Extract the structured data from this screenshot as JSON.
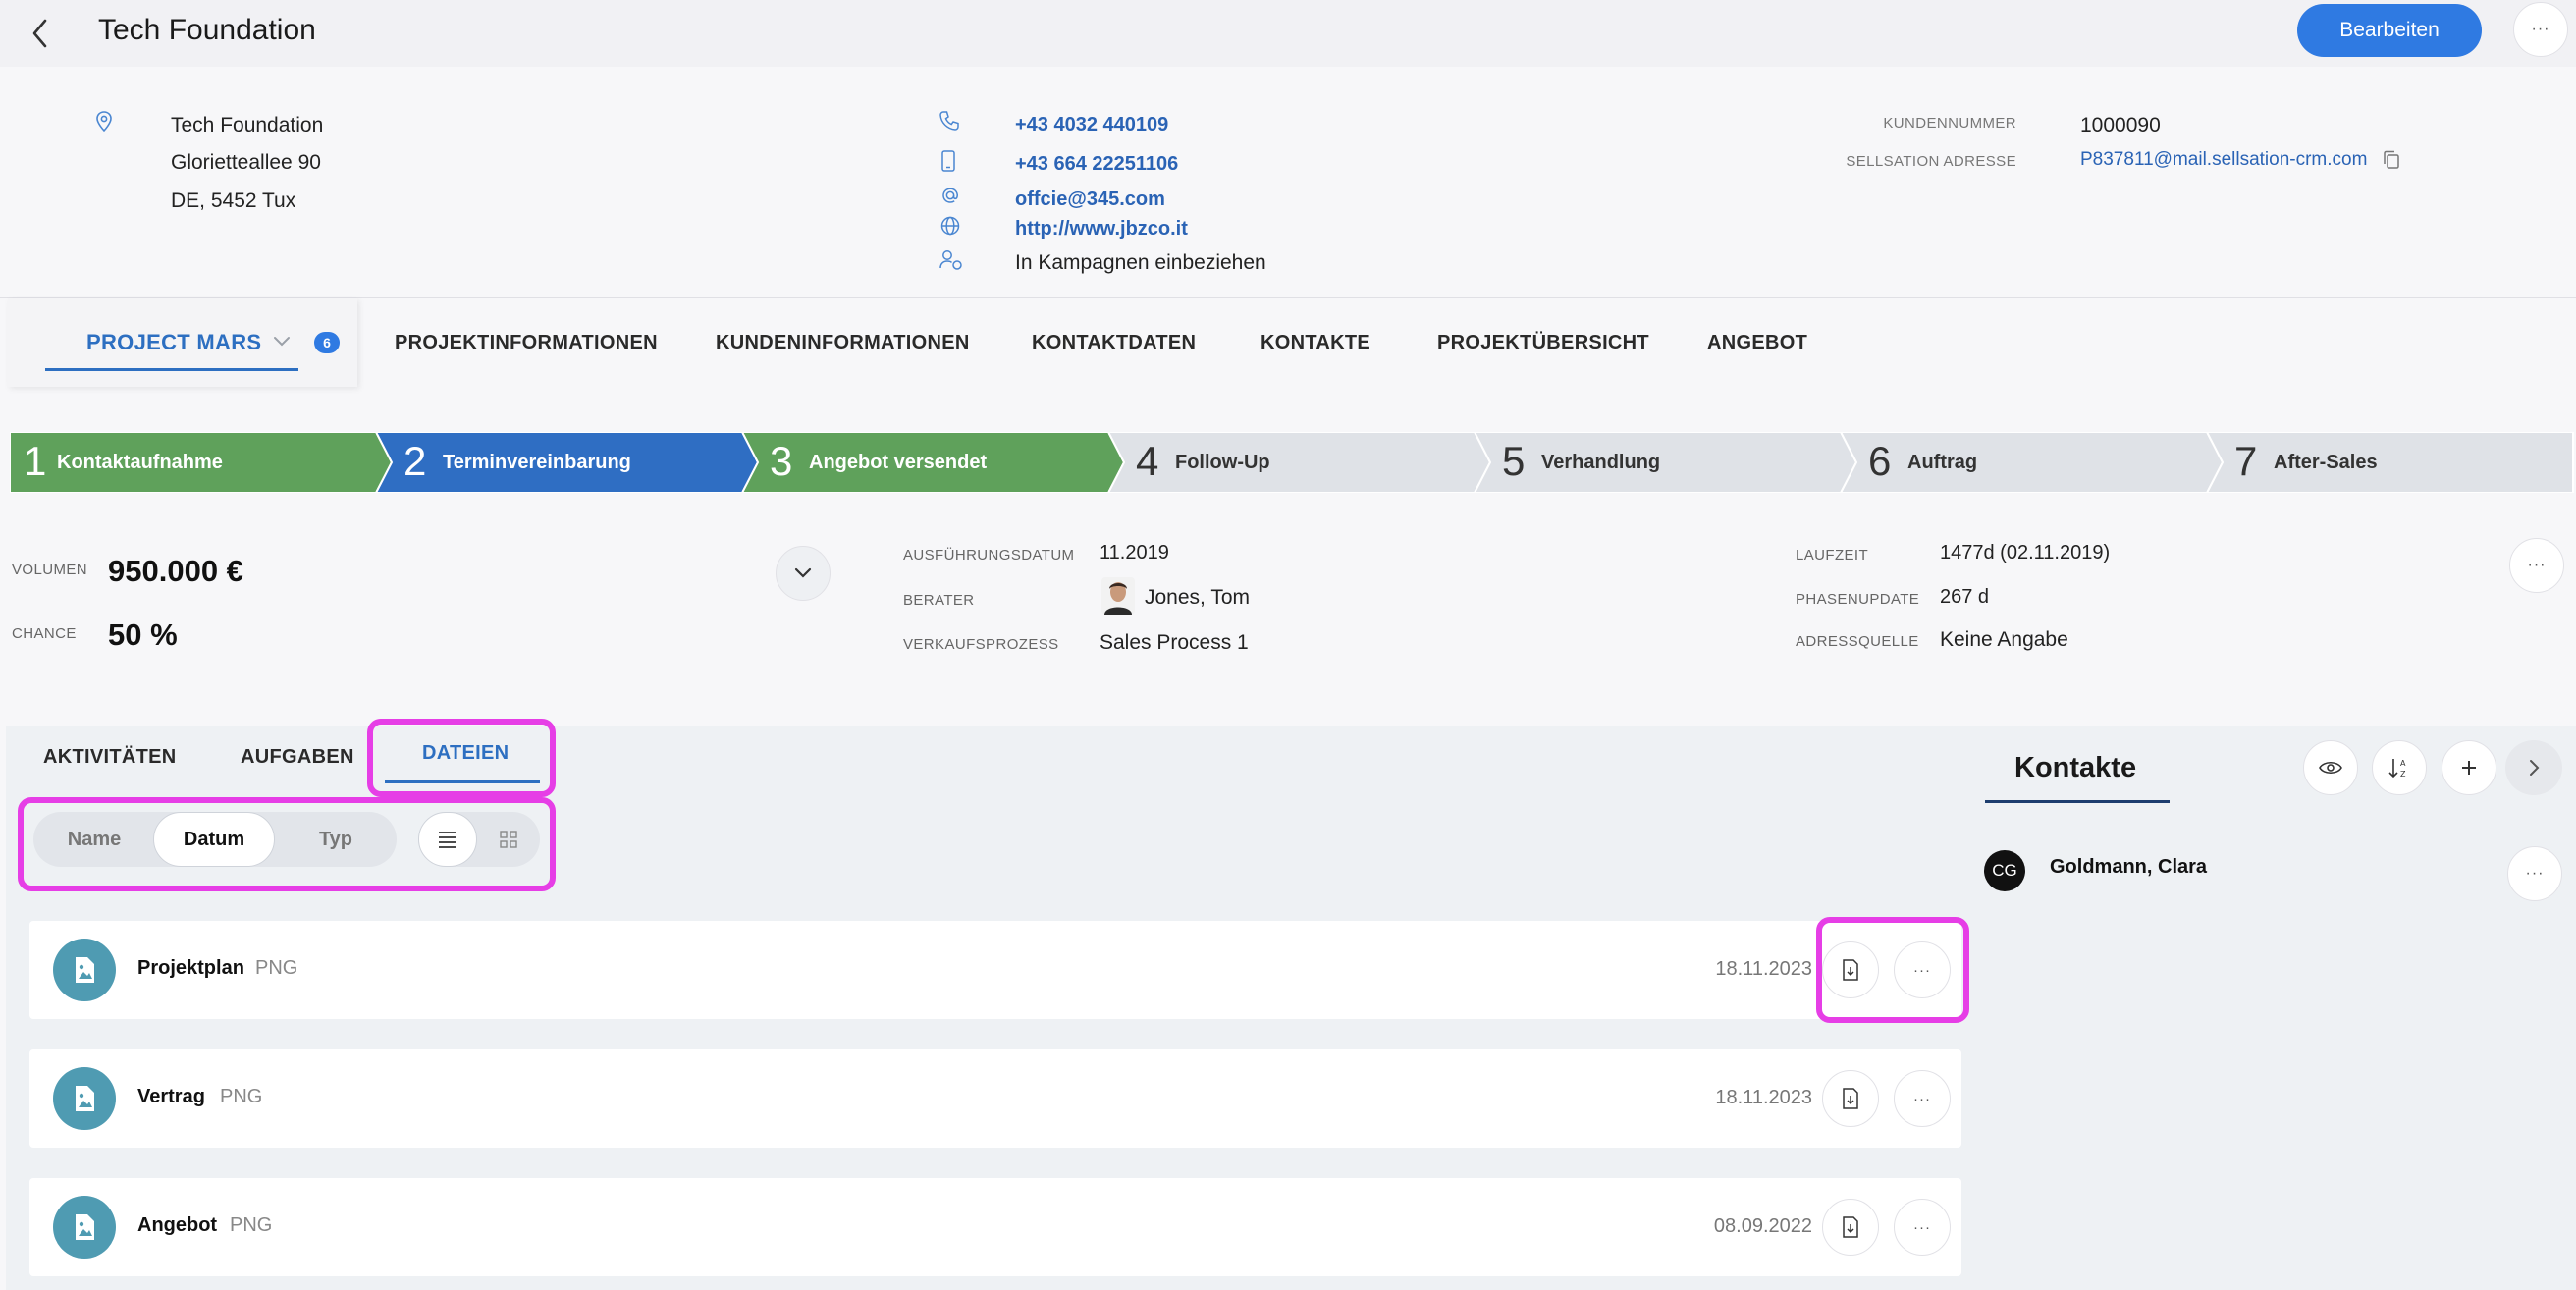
{
  "header": {
    "title": "Tech Foundation",
    "edit_label": "Bearbeiten",
    "more_label": "···"
  },
  "address": {
    "name": "Tech Foundation",
    "street": "Glorietteallee 90",
    "city": "DE, 5452 Tux"
  },
  "contact_info": {
    "phone": "+43 4032 440109",
    "mobile": "+43 664 22251106",
    "email": "offcie@345.com",
    "website": "http://www.jbzco.it",
    "campaigns": "In Kampagnen einbeziehen"
  },
  "customer": {
    "number_label": "KUNDENNUMMER",
    "number_value": "1000090",
    "sellsation_label": "SELLSATION ADRESSE",
    "sellsation_value": "P837811@mail.sellsation-crm.com"
  },
  "project_tab": {
    "label": "PROJECT MARS",
    "badge": "6"
  },
  "nav_tabs": [
    "PROJEKTINFORMATIONEN",
    "KUNDENINFORMATIONEN",
    "KONTAKTDATEN",
    "KONTAKTE",
    "PROJEKTÜBERSICHT",
    "ANGEBOT"
  ],
  "pipeline": [
    {
      "num": "1",
      "label": "Kontaktaufnahme",
      "status": "done",
      "color": "#5fa15b"
    },
    {
      "num": "2",
      "label": "Terminvereinbarung",
      "status": "current",
      "color": "#2f6ec3"
    },
    {
      "num": "3",
      "label": "Angebot versendet",
      "status": "done",
      "color": "#5fa15b"
    },
    {
      "num": "4",
      "label": "Follow-Up",
      "status": "open",
      "color": "#dfe2e7"
    },
    {
      "num": "5",
      "label": "Verhandlung",
      "status": "open",
      "color": "#dfe2e7"
    },
    {
      "num": "6",
      "label": "Auftrag",
      "status": "open",
      "color": "#dfe2e7"
    },
    {
      "num": "7",
      "label": "After-Sales",
      "status": "open",
      "color": "#dfe2e7"
    }
  ],
  "metrics": {
    "volumen_label": "VOLUMEN",
    "volumen_value": "950.000 €",
    "chance_label": "CHANCE",
    "chance_value": "50 %",
    "ausfuehrung_label": "AUSFÜHRUNGSDATUM",
    "ausfuehrung_value": "11.2019",
    "berater_label": "BERATER",
    "berater_value": "Jones, Tom",
    "prozess_label": "VERKAUFSPROZESS",
    "prozess_value": "Sales Process 1",
    "laufzeit_label": "LAUFZEIT",
    "laufzeit_value": "1477d (02.11.2019)",
    "phasenupdate_label": "PHASENUPDATE",
    "phasenupdate_value": "267 d",
    "adressquelle_label": "ADRESSQUELLE",
    "adressquelle_value": "Keine Angabe"
  },
  "sub_tabs": {
    "activities": "AKTIVITÄTEN",
    "tasks": "AUFGABEN",
    "files": "DATEIEN",
    "active": "files"
  },
  "sort": {
    "options": [
      "Name",
      "Datum",
      "Typ"
    ],
    "active": "Datum"
  },
  "files": [
    {
      "name": "Projektplan",
      "type": "PNG",
      "date": "18.11.2023"
    },
    {
      "name": "Vertrag",
      "type": "PNG",
      "date": "18.11.2023"
    },
    {
      "name": "Angebot",
      "type": "PNG",
      "date": "08.09.2022"
    }
  ],
  "right_panel": {
    "title": "Kontakte",
    "contacts": [
      {
        "initials": "CG",
        "name": "Goldmann, Clara"
      }
    ]
  },
  "colors": {
    "accent": "#2f7ae2",
    "highlight": "#e63ee6",
    "file_icon": "#4f9bb2"
  }
}
